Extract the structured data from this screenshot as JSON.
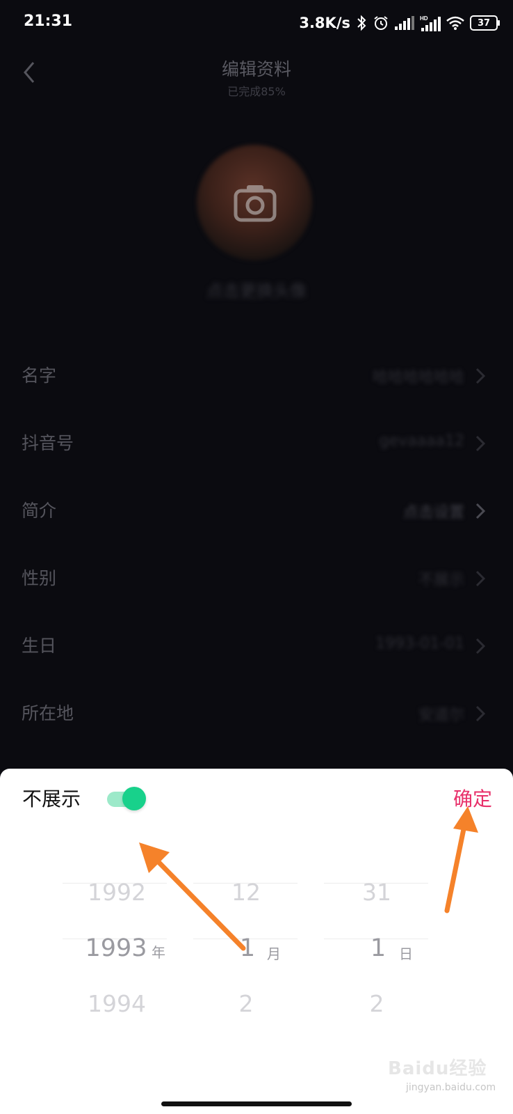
{
  "status_bar": {
    "time": "21:31",
    "network_speed": "3.8K/s",
    "battery": "37",
    "icons": [
      "bluetooth-icon",
      "alarm-icon",
      "signal-icon",
      "hd-signal-icon",
      "wifi-icon",
      "battery-icon"
    ]
  },
  "header": {
    "title": "编辑资料",
    "subtitle": "已完成85%"
  },
  "avatar": {
    "caption": "点击更换头像"
  },
  "profile_rows": [
    {
      "label": "名字",
      "value": "哈哈哈哈哈哈"
    },
    {
      "label": "抖音号",
      "value": "gevaaaa12"
    },
    {
      "label": "简介",
      "value": "点击设置"
    },
    {
      "label": "性别",
      "value": "不展示"
    },
    {
      "label": "生日",
      "value": "1993-01-01"
    },
    {
      "label": "所在地",
      "value": "安道尔"
    }
  ],
  "date_sheet": {
    "hide_label": "不展示",
    "hide_toggle_on": true,
    "confirm_label": "确定",
    "year": {
      "prev": "1992",
      "selected": "1993",
      "next": "1994",
      "unit": "年"
    },
    "month": {
      "prev": "12",
      "selected": "1",
      "next": "2",
      "unit": "月"
    },
    "day": {
      "prev": "31",
      "selected": "1",
      "next": "2",
      "unit": "日"
    }
  },
  "watermark": {
    "main": "Baidu经验",
    "sub": "jingyan.baidu.com"
  },
  "colors": {
    "background": "#0b0b10",
    "confirm": "#e8306a",
    "toggle_on": "#18d18b",
    "annotation_arrow": "#f5822a"
  }
}
